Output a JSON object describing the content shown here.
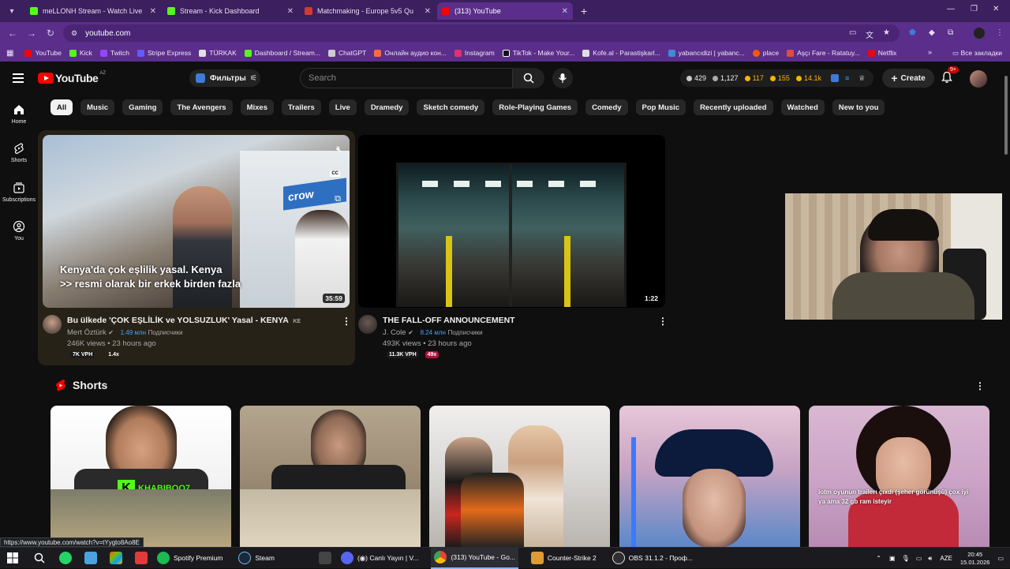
{
  "browser": {
    "tabs": [
      {
        "label": "meLLONH Stream - Watch Live",
        "color": "#53fc18",
        "active": false
      },
      {
        "label": "Stream - Kick Dashboard",
        "color": "#53fc18",
        "active": false
      },
      {
        "label": "Matchmaking - Europe 5v5 Qu",
        "color": "#d13b2e",
        "active": false
      },
      {
        "label": "(313) YouTube",
        "color": "#ff0000",
        "active": true
      }
    ],
    "url": "youtube.com",
    "bookmarks": [
      {
        "label": "YouTube",
        "color": "#ff0000"
      },
      {
        "label": "Kick",
        "color": "#53fc18"
      },
      {
        "label": "Twitch",
        "color": "#9146ff"
      },
      {
        "label": "Stripe Express",
        "color": "#635bff"
      },
      {
        "label": "TÜRKAK",
        "color": "#e0e0e0"
      },
      {
        "label": "Dashboard / Stream...",
        "color": "#53fc18"
      },
      {
        "label": "ChatGPT",
        "color": "#cccccc"
      },
      {
        "label": "Онлайн аудио кон...",
        "color": "#ff6a3d"
      },
      {
        "label": "Instagram",
        "color": "#e1306c"
      },
      {
        "label": "TikTok - Make Your...",
        "color": "#111111"
      },
      {
        "label": "Kofe.al - Parastişkarl...",
        "color": "#e0e0e0"
      },
      {
        "label": "yabancıdizi | yabanc...",
        "color": "#3e8bd6"
      },
      {
        "label": "place",
        "color": "#ff5700"
      },
      {
        "label": "Aşçı Fare - Ratatuy...",
        "color": "#e34b3b"
      },
      {
        "label": "Netflix",
        "color": "#e50914"
      }
    ],
    "all_bookmarks": "Все закладки",
    "status_url": "https://www.youtube.com/watch?v=tYygto8Ao8E"
  },
  "youtube": {
    "logo_text": "YouTube",
    "country_code": "AZ",
    "filters_label": "Фильтры",
    "search_placeholder": "Search",
    "stats": {
      "s1": "429",
      "s2": "1,127",
      "s3": "117",
      "s4": "155",
      "s5": "14.1k"
    },
    "create_label": "Create",
    "notifications_badge": "9+",
    "rail": [
      {
        "label": "Home"
      },
      {
        "label": "Shorts"
      },
      {
        "label": "Subscriptions"
      },
      {
        "label": "You"
      }
    ],
    "chips": [
      "All",
      "Music",
      "Gaming",
      "The Avengers",
      "Mixes",
      "Trailers",
      "Live",
      "Dramedy",
      "Sketch comedy",
      "Role-Playing Games",
      "Comedy",
      "Pop Music",
      "Recently uploaded",
      "Watched",
      "New to you"
    ],
    "videos": [
      {
        "title": "Bu ülkede 'ÇOK EŞLİLİK ve YOLSUZLUK' Yasal - KENYA",
        "title_suffix": "KE",
        "channel": "Mert Öztürk",
        "subs": "1.49 млн",
        "subs_word": "Подписчики",
        "meta": "246K views • 23 hours ago",
        "vph": "7K VPH",
        "mult": "1.4x",
        "duration": "35:59",
        "overlay_line1": "Kenya'da çok eşlilik yasal. Kenya",
        "overlay_line2": ">> resmi olarak bir erkek birden fazla"
      },
      {
        "title": "THE FALL-OFF ANNOUNCEMENT",
        "channel": "J. Cole",
        "subs": "8.24 млн",
        "subs_word": "Подписчики",
        "meta": "493K views • 23 hours ago",
        "vph": "11.3K VPH",
        "mult": "49x",
        "duration": "1:22"
      }
    ],
    "shorts_title": "Shorts",
    "shorts": [
      {
        "caption": "KHABIBOO7"
      },
      {
        "caption": ""
      },
      {
        "caption": ""
      },
      {
        "caption": ""
      },
      {
        "caption_line1": "lotm oyunun trailerı çıxdı (şeher görünüşü) çox iyi",
        "caption_line2": "ya ama 32 gb ram isteyir"
      }
    ]
  },
  "taskbar": {
    "apps": [
      {
        "label": "Spotify Premium",
        "color": "#1db954"
      },
      {
        "label": "Steam",
        "color": "#1b2838"
      },
      {
        "label": "(◉) Canlı Yayın | V...",
        "color": "#5865f2"
      },
      {
        "label": "(313) YouTube - Go...",
        "color": "#4285f4"
      },
      {
        "label": "Counter-Strike 2",
        "color": "#de9b35"
      },
      {
        "label": "OBS 31.1.2 - Проф...",
        "color": "#302e31"
      }
    ],
    "lang": "AZE",
    "time": "20:45",
    "date": "15.01.2026"
  }
}
